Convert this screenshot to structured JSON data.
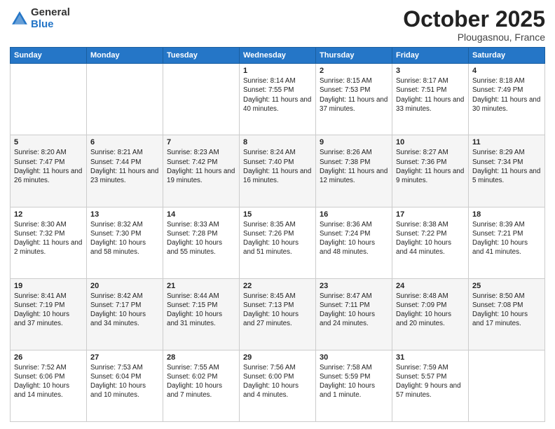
{
  "logo": {
    "general": "General",
    "blue": "Blue"
  },
  "header": {
    "month": "October 2025",
    "location": "Plougasnou, France"
  },
  "weekdays": [
    "Sunday",
    "Monday",
    "Tuesday",
    "Wednesday",
    "Thursday",
    "Friday",
    "Saturday"
  ],
  "weeks": [
    [
      {
        "day": "",
        "sunrise": "",
        "sunset": "",
        "daylight": ""
      },
      {
        "day": "",
        "sunrise": "",
        "sunset": "",
        "daylight": ""
      },
      {
        "day": "",
        "sunrise": "",
        "sunset": "",
        "daylight": ""
      },
      {
        "day": "1",
        "sunrise": "Sunrise: 8:14 AM",
        "sunset": "Sunset: 7:55 PM",
        "daylight": "Daylight: 11 hours and 40 minutes."
      },
      {
        "day": "2",
        "sunrise": "Sunrise: 8:15 AM",
        "sunset": "Sunset: 7:53 PM",
        "daylight": "Daylight: 11 hours and 37 minutes."
      },
      {
        "day": "3",
        "sunrise": "Sunrise: 8:17 AM",
        "sunset": "Sunset: 7:51 PM",
        "daylight": "Daylight: 11 hours and 33 minutes."
      },
      {
        "day": "4",
        "sunrise": "Sunrise: 8:18 AM",
        "sunset": "Sunset: 7:49 PM",
        "daylight": "Daylight: 11 hours and 30 minutes."
      }
    ],
    [
      {
        "day": "5",
        "sunrise": "Sunrise: 8:20 AM",
        "sunset": "Sunset: 7:47 PM",
        "daylight": "Daylight: 11 hours and 26 minutes."
      },
      {
        "day": "6",
        "sunrise": "Sunrise: 8:21 AM",
        "sunset": "Sunset: 7:44 PM",
        "daylight": "Daylight: 11 hours and 23 minutes."
      },
      {
        "day": "7",
        "sunrise": "Sunrise: 8:23 AM",
        "sunset": "Sunset: 7:42 PM",
        "daylight": "Daylight: 11 hours and 19 minutes."
      },
      {
        "day": "8",
        "sunrise": "Sunrise: 8:24 AM",
        "sunset": "Sunset: 7:40 PM",
        "daylight": "Daylight: 11 hours and 16 minutes."
      },
      {
        "day": "9",
        "sunrise": "Sunrise: 8:26 AM",
        "sunset": "Sunset: 7:38 PM",
        "daylight": "Daylight: 11 hours and 12 minutes."
      },
      {
        "day": "10",
        "sunrise": "Sunrise: 8:27 AM",
        "sunset": "Sunset: 7:36 PM",
        "daylight": "Daylight: 11 hours and 9 minutes."
      },
      {
        "day": "11",
        "sunrise": "Sunrise: 8:29 AM",
        "sunset": "Sunset: 7:34 PM",
        "daylight": "Daylight: 11 hours and 5 minutes."
      }
    ],
    [
      {
        "day": "12",
        "sunrise": "Sunrise: 8:30 AM",
        "sunset": "Sunset: 7:32 PM",
        "daylight": "Daylight: 11 hours and 2 minutes."
      },
      {
        "day": "13",
        "sunrise": "Sunrise: 8:32 AM",
        "sunset": "Sunset: 7:30 PM",
        "daylight": "Daylight: 10 hours and 58 minutes."
      },
      {
        "day": "14",
        "sunrise": "Sunrise: 8:33 AM",
        "sunset": "Sunset: 7:28 PM",
        "daylight": "Daylight: 10 hours and 55 minutes."
      },
      {
        "day": "15",
        "sunrise": "Sunrise: 8:35 AM",
        "sunset": "Sunset: 7:26 PM",
        "daylight": "Daylight: 10 hours and 51 minutes."
      },
      {
        "day": "16",
        "sunrise": "Sunrise: 8:36 AM",
        "sunset": "Sunset: 7:24 PM",
        "daylight": "Daylight: 10 hours and 48 minutes."
      },
      {
        "day": "17",
        "sunrise": "Sunrise: 8:38 AM",
        "sunset": "Sunset: 7:22 PM",
        "daylight": "Daylight: 10 hours and 44 minutes."
      },
      {
        "day": "18",
        "sunrise": "Sunrise: 8:39 AM",
        "sunset": "Sunset: 7:21 PM",
        "daylight": "Daylight: 10 hours and 41 minutes."
      }
    ],
    [
      {
        "day": "19",
        "sunrise": "Sunrise: 8:41 AM",
        "sunset": "Sunset: 7:19 PM",
        "daylight": "Daylight: 10 hours and 37 minutes."
      },
      {
        "day": "20",
        "sunrise": "Sunrise: 8:42 AM",
        "sunset": "Sunset: 7:17 PM",
        "daylight": "Daylight: 10 hours and 34 minutes."
      },
      {
        "day": "21",
        "sunrise": "Sunrise: 8:44 AM",
        "sunset": "Sunset: 7:15 PM",
        "daylight": "Daylight: 10 hours and 31 minutes."
      },
      {
        "day": "22",
        "sunrise": "Sunrise: 8:45 AM",
        "sunset": "Sunset: 7:13 PM",
        "daylight": "Daylight: 10 hours and 27 minutes."
      },
      {
        "day": "23",
        "sunrise": "Sunrise: 8:47 AM",
        "sunset": "Sunset: 7:11 PM",
        "daylight": "Daylight: 10 hours and 24 minutes."
      },
      {
        "day": "24",
        "sunrise": "Sunrise: 8:48 AM",
        "sunset": "Sunset: 7:09 PM",
        "daylight": "Daylight: 10 hours and 20 minutes."
      },
      {
        "day": "25",
        "sunrise": "Sunrise: 8:50 AM",
        "sunset": "Sunset: 7:08 PM",
        "daylight": "Daylight: 10 hours and 17 minutes."
      }
    ],
    [
      {
        "day": "26",
        "sunrise": "Sunrise: 7:52 AM",
        "sunset": "Sunset: 6:06 PM",
        "daylight": "Daylight: 10 hours and 14 minutes."
      },
      {
        "day": "27",
        "sunrise": "Sunrise: 7:53 AM",
        "sunset": "Sunset: 6:04 PM",
        "daylight": "Daylight: 10 hours and 10 minutes."
      },
      {
        "day": "28",
        "sunrise": "Sunrise: 7:55 AM",
        "sunset": "Sunset: 6:02 PM",
        "daylight": "Daylight: 10 hours and 7 minutes."
      },
      {
        "day": "29",
        "sunrise": "Sunrise: 7:56 AM",
        "sunset": "Sunset: 6:00 PM",
        "daylight": "Daylight: 10 hours and 4 minutes."
      },
      {
        "day": "30",
        "sunrise": "Sunrise: 7:58 AM",
        "sunset": "Sunset: 5:59 PM",
        "daylight": "Daylight: 10 hours and 1 minute."
      },
      {
        "day": "31",
        "sunrise": "Sunrise: 7:59 AM",
        "sunset": "Sunset: 5:57 PM",
        "daylight": "Daylight: 9 hours and 57 minutes."
      },
      {
        "day": "",
        "sunrise": "",
        "sunset": "",
        "daylight": ""
      }
    ]
  ]
}
